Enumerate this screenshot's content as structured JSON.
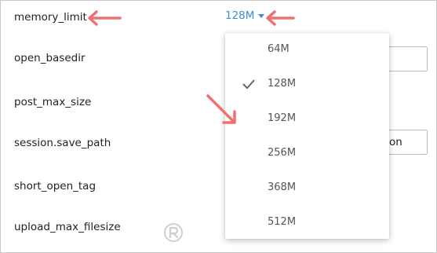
{
  "settings": {
    "memory_limit_label": "memory_limit",
    "open_basedir_label": "open_basedir",
    "post_max_size_label": "post_max_size",
    "session_save_path_label": "session.save_path",
    "short_open_tag_label": "short_open_tag",
    "upload_max_filesize_label": "upload_max_filesize",
    "session_save_path_value": "on"
  },
  "memory_limit": {
    "selected": "128M",
    "options": [
      "64M",
      "128M",
      "192M",
      "256M",
      "368M",
      "512M"
    ],
    "checked_index": 1
  },
  "colors": {
    "accent": "#3a8fd6",
    "annotation_arrow": "#f07070"
  },
  "icons": {
    "caret": "chevron-down-icon",
    "check": "check-icon",
    "watermark": "watermark-logo-icon"
  }
}
